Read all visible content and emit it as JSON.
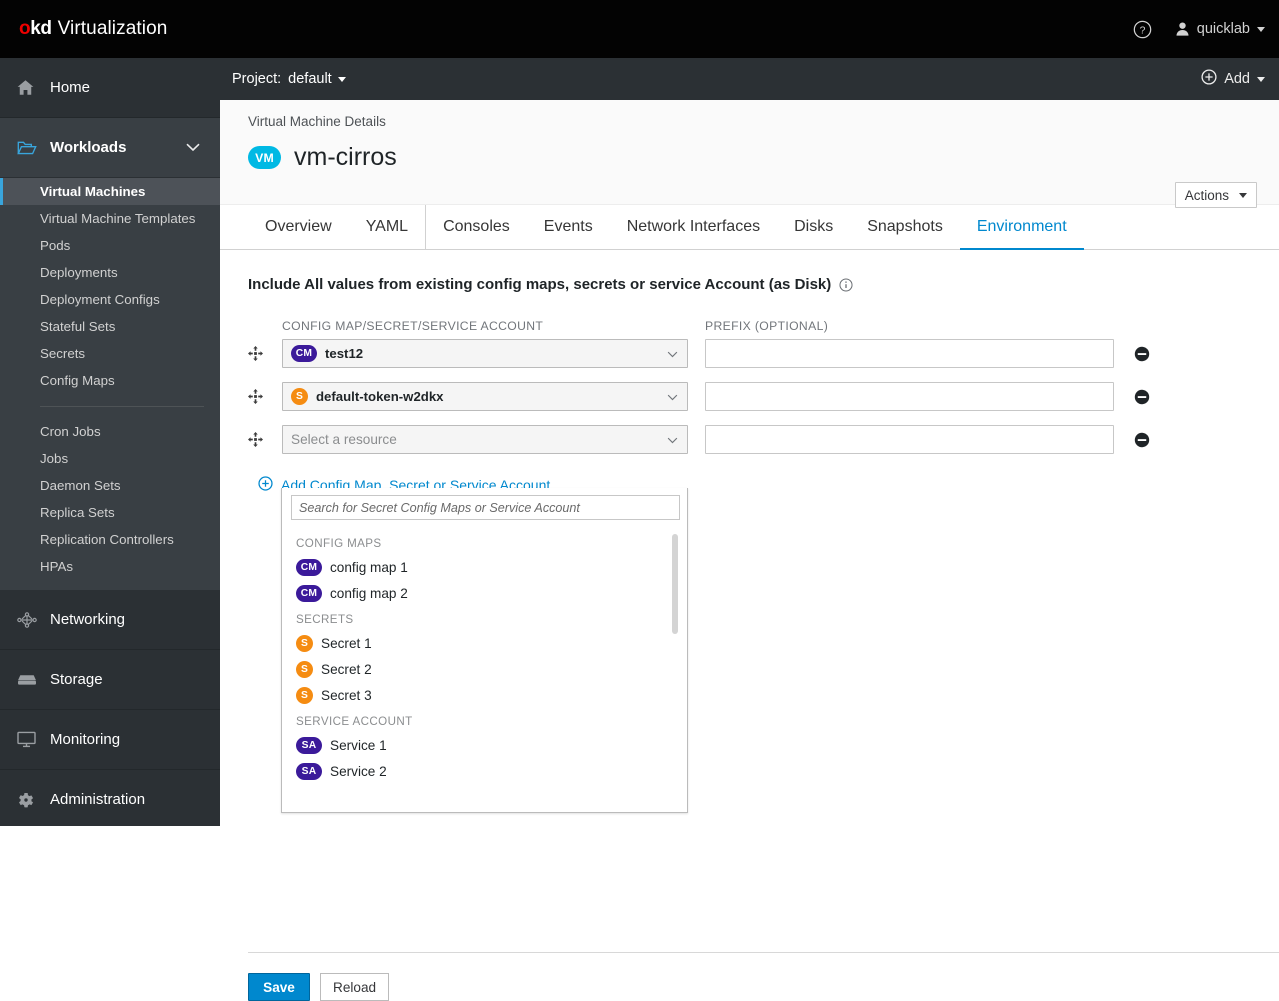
{
  "masthead": {
    "brand_prefix_o": "o",
    "brand_prefix_kd": "kd",
    "brand_suffix": "Virtualization",
    "help_icon": "help-circle-icon",
    "user_icon": "user-icon",
    "username": "quicklab"
  },
  "sidebar": {
    "sections": [
      {
        "label": "Home",
        "icon": "home-icon",
        "expanded": false,
        "children": []
      },
      {
        "label": "Workloads",
        "icon": "folder-open-icon",
        "expanded": true,
        "children": [
          {
            "label": "Virtual Machines",
            "active": true
          },
          {
            "label": "Virtual Machine Templates",
            "active": false
          },
          {
            "label": "Pods",
            "active": false
          },
          {
            "label": "Deployments",
            "active": false
          },
          {
            "label": "Deployment Configs",
            "active": false
          },
          {
            "label": "Stateful Sets",
            "active": false
          },
          {
            "label": "Secrets",
            "active": false
          },
          {
            "label": "Config Maps",
            "active": false
          },
          {
            "divider": true
          },
          {
            "label": "Cron Jobs",
            "active": false
          },
          {
            "label": "Jobs",
            "active": false
          },
          {
            "label": "Daemon Sets",
            "active": false
          },
          {
            "label": "Replica Sets",
            "active": false
          },
          {
            "label": "Replication Controllers",
            "active": false
          },
          {
            "label": "HPAs",
            "active": false
          }
        ]
      },
      {
        "label": "Networking",
        "icon": "network-icon",
        "expanded": false,
        "children": []
      },
      {
        "label": "Storage",
        "icon": "storage-icon",
        "expanded": false,
        "children": []
      },
      {
        "label": "Monitoring",
        "icon": "monitor-icon",
        "expanded": false,
        "children": []
      },
      {
        "label": "Administration",
        "icon": "gear-icon",
        "expanded": false,
        "children": []
      }
    ]
  },
  "project_bar": {
    "label": "Project:",
    "value": "default",
    "add_label": "Add",
    "add_icon": "plus-circle-icon"
  },
  "page_head": {
    "breadcrumb": "Virtual Machine Details",
    "badge": "VM",
    "title": "vm-cirros",
    "actions_label": "Actions"
  },
  "tabs": [
    {
      "label": "Overview",
      "active": false
    },
    {
      "label": "YAML",
      "active": false
    },
    {
      "label": "Consoles",
      "active": false
    },
    {
      "label": "Events",
      "active": false
    },
    {
      "label": "Network Interfaces",
      "active": false
    },
    {
      "label": "Disks",
      "active": false
    },
    {
      "label": "Snapshots",
      "active": false
    },
    {
      "label": "Environment",
      "active": true
    }
  ],
  "form": {
    "description": "Include All values from existing config maps, secrets or service Account (as Disk)",
    "info_icon": "info-circle-icon",
    "col_head_resource": "CONFIG MAP/SECRET/SERVICE ACCOUNT",
    "col_head_prefix": "PREFIX (OPTIONAL)",
    "rows": [
      {
        "badge": "CM",
        "badge_type": "cm",
        "value": "test12",
        "prefix": "",
        "open": false
      },
      {
        "badge": "S",
        "badge_type": "s",
        "value": "default-token-w2dkx",
        "prefix": "",
        "open": false
      },
      {
        "badge": "",
        "badge_type": "",
        "value": "",
        "placeholder": "Select a resource",
        "prefix": "",
        "open": true
      }
    ],
    "prefix_placeholder": "",
    "remove_icon": "minus-circle-icon",
    "add_link_label": "Add Config Map, Secret or Service Account",
    "add_link_icon": "plus-circle-icon",
    "save_label": "Save",
    "reload_label": "Reload"
  },
  "dropdown": {
    "search_placeholder": "Search for Secret Config Maps or Service Account",
    "groups": [
      {
        "title": "CONFIG MAPS",
        "items": [
          {
            "badge": "CM",
            "badge_type": "cm",
            "label": "config map 1"
          },
          {
            "badge": "CM",
            "badge_type": "cm",
            "label": "config map 2"
          }
        ]
      },
      {
        "title": "SECRETS",
        "items": [
          {
            "badge": "S",
            "badge_type": "s",
            "label": "Secret 1"
          },
          {
            "badge": "S",
            "badge_type": "s",
            "label": "Secret 2"
          },
          {
            "badge": "S",
            "badge_type": "s",
            "label": "Secret 3"
          }
        ]
      },
      {
        "title": "SERVICE ACCOUNT",
        "items": [
          {
            "badge": "SA",
            "badge_type": "sa",
            "label": "Service 1"
          },
          {
            "badge": "SA",
            "badge_type": "sa",
            "label": "Service 2"
          }
        ]
      }
    ]
  },
  "colors": {
    "masthead_bg": "#030303",
    "sidebar_bg": "#393f44",
    "accent_blue": "#0088ce",
    "vm_badge": "#00b9e4",
    "configmap_purple": "#3b1a9a",
    "secret_orange": "#f58c12",
    "brand_red": "#ee0000"
  }
}
